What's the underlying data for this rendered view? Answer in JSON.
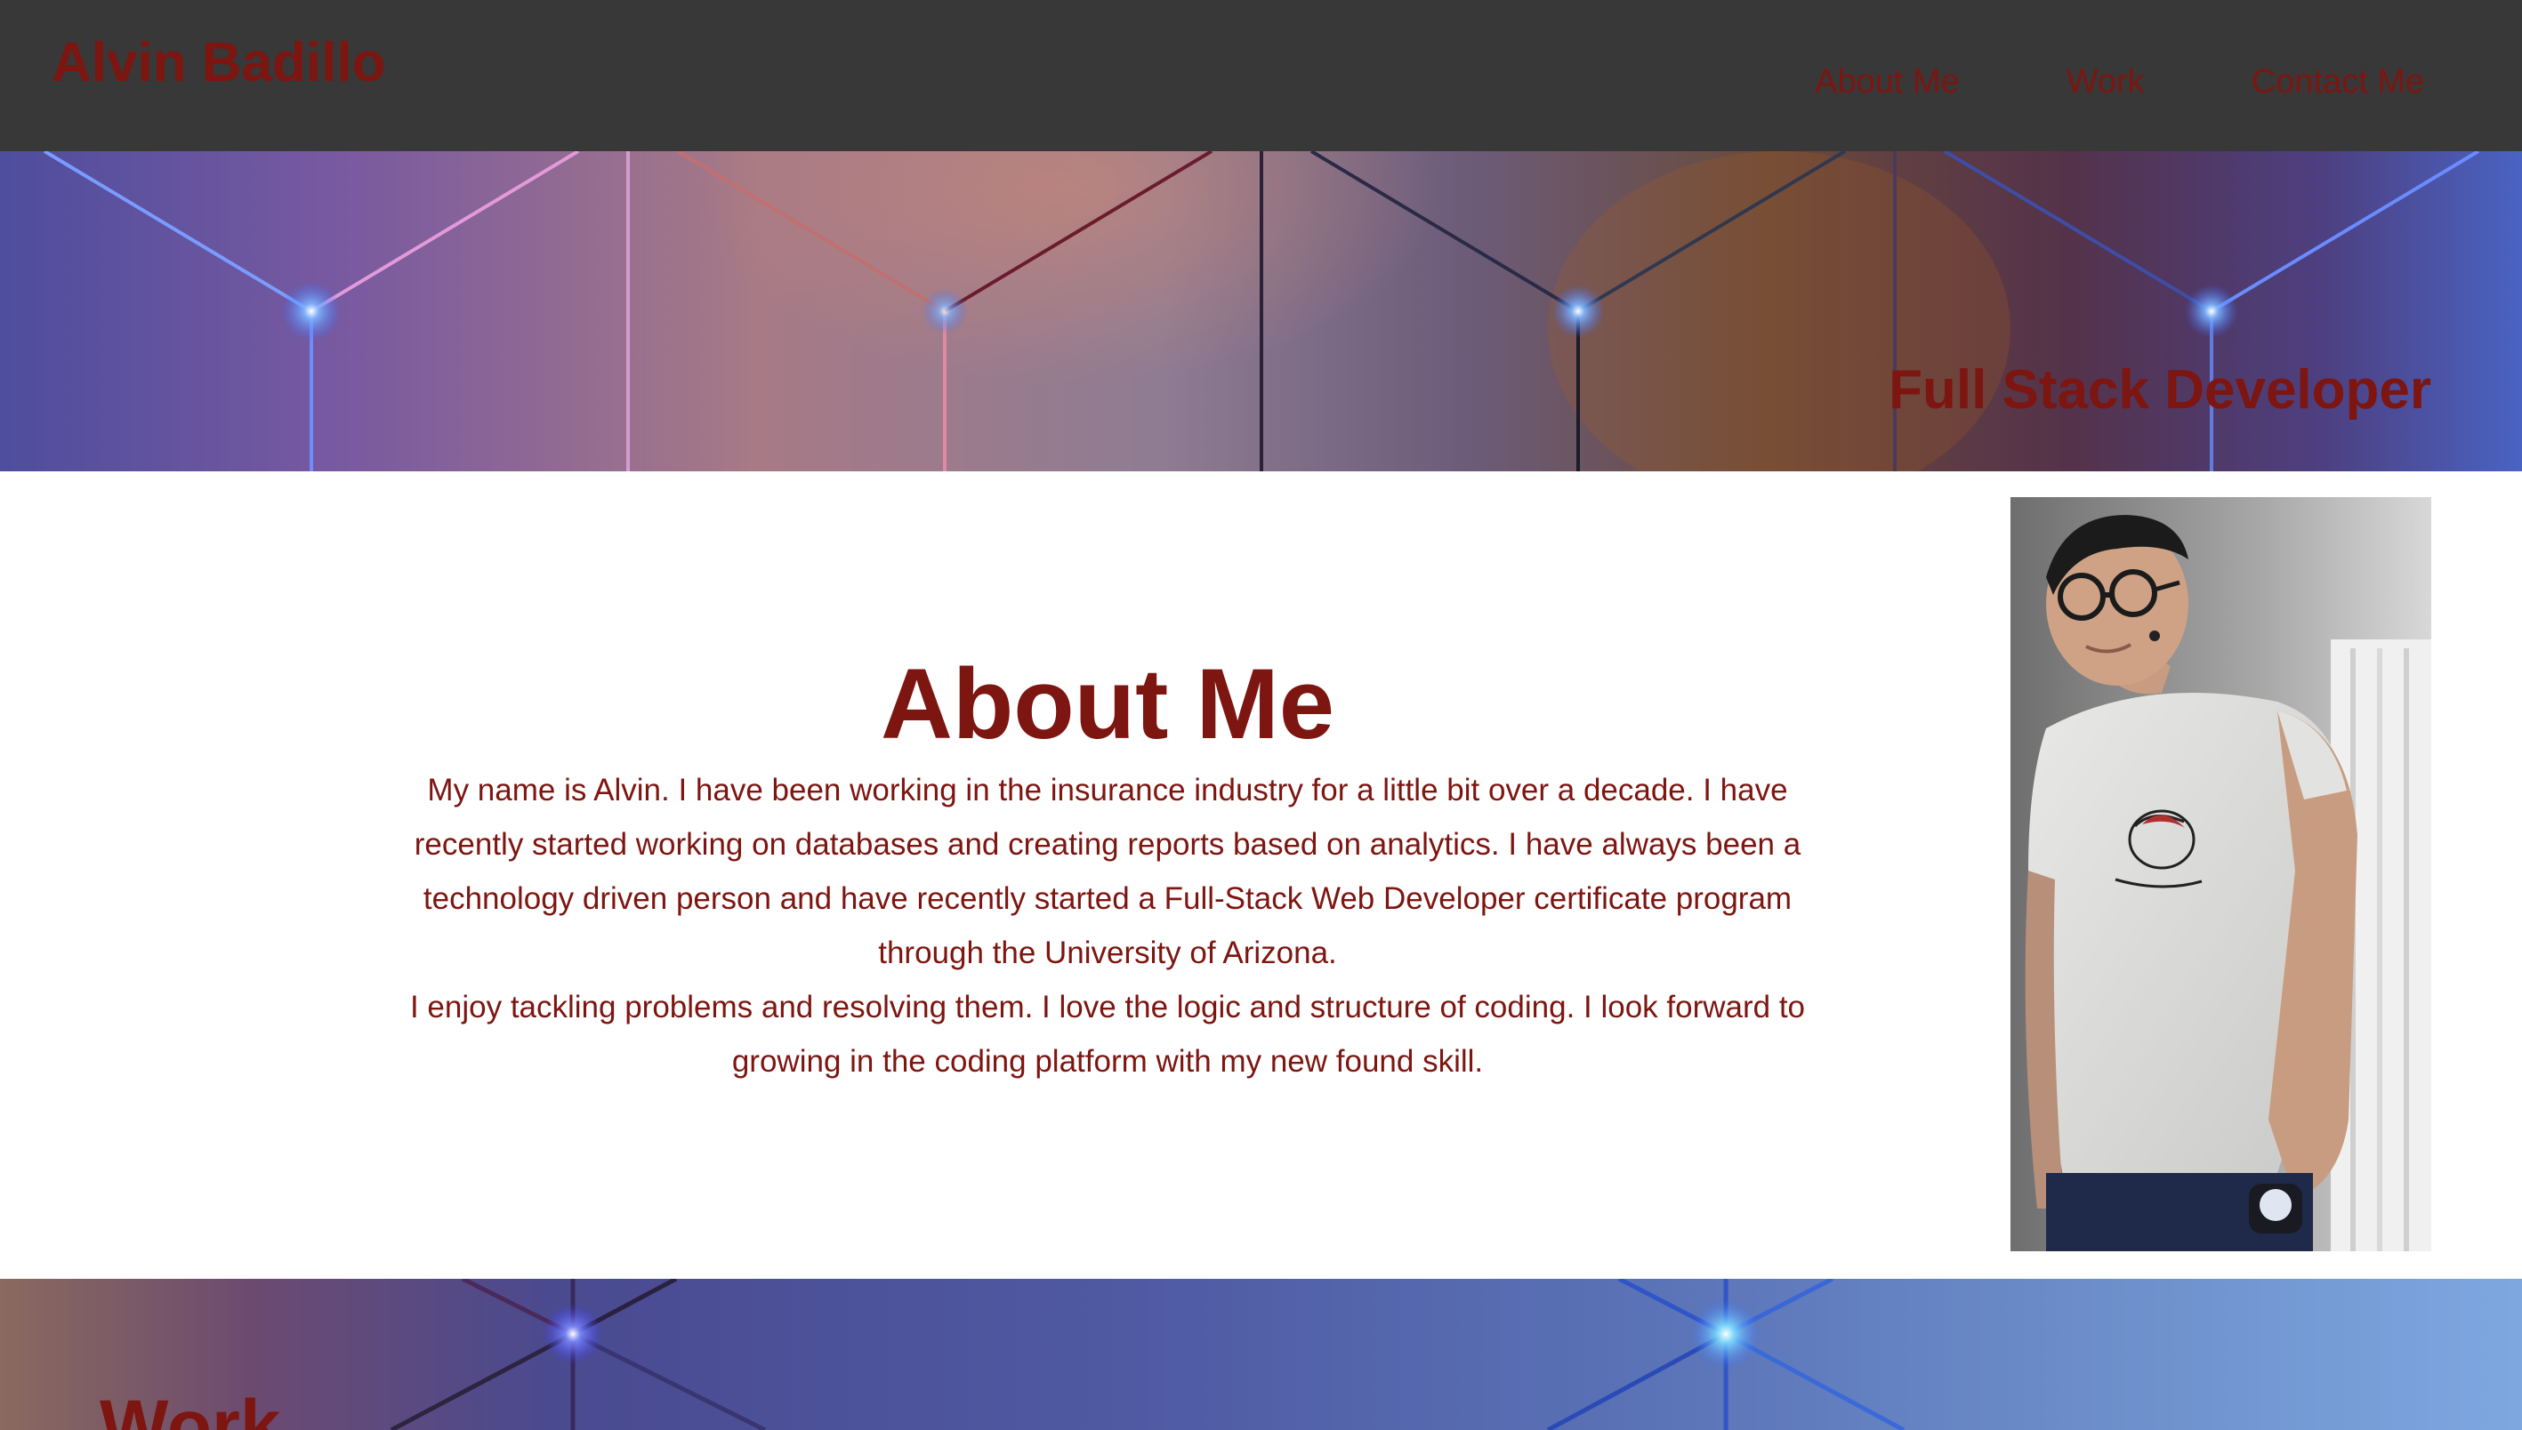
{
  "header": {
    "site_name": "Alvin Badillo",
    "nav": [
      {
        "label": "About Me"
      },
      {
        "label": "Work"
      },
      {
        "label": "Contact Me"
      }
    ]
  },
  "hero": {
    "title": "Full Stack Developer"
  },
  "about": {
    "heading": "About Me",
    "paragraphs": [
      "My name is Alvin. I have been working in the insurance industry for a little bit over a decade. I have recently started working on databases and creating reports based on analytics. I have always been a technology driven person and have recently started a Full-Stack Web Developer certificate program through the University of Arizona.",
      "I enjoy tackling problems and resolving them. I love the logic and structure of coding. I look forward to growing in the coding platform with my new found skill."
    ]
  },
  "work": {
    "heading": "Work"
  },
  "colors": {
    "accent_text": "#7d1510",
    "header_bg": "#383838"
  }
}
